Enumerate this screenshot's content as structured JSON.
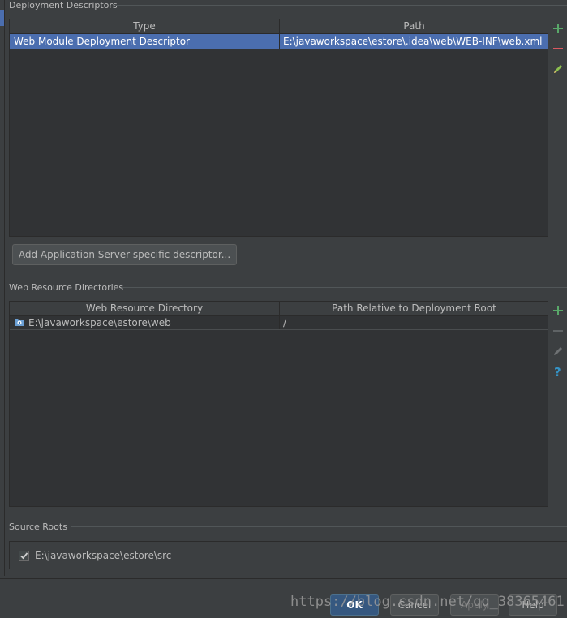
{
  "deployment_descriptors": {
    "title": "Deployment Descriptors",
    "columns": [
      "Type",
      "Path"
    ],
    "rows": [
      {
        "type": "Web Module Deployment Descriptor",
        "path": "E:\\javaworkspace\\estore\\.idea\\web\\WEB-INF\\web.xml"
      }
    ],
    "add_button_label": "Add Application Server specific descriptor..."
  },
  "web_resource_directories": {
    "title": "Web Resource Directories",
    "columns": [
      "Web Resource Directory",
      "Path Relative to Deployment Root"
    ],
    "rows": [
      {
        "directory": "E:\\javaworkspace\\estore\\web",
        "relative_path": "/"
      }
    ]
  },
  "source_roots": {
    "title": "Source Roots",
    "items": [
      {
        "label": "E:\\javaworkspace\\estore\\src",
        "checked": true
      }
    ]
  },
  "footer": {
    "ok_label": "OK",
    "cancel_label": "Cancel",
    "apply_label": "Apply",
    "help_label": "Help",
    "watermark": "https://blog.csdn.net/qq_38365461"
  },
  "colors": {
    "background": "#3c3f41",
    "selection": "#4b6eaf",
    "add_green": "#59a869",
    "remove_red": "#db5860",
    "help_blue": "#3592c4"
  }
}
